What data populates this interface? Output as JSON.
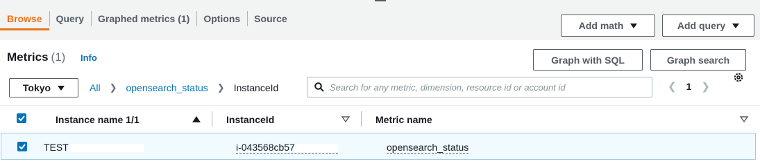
{
  "tabs": [
    {
      "label": "Browse",
      "active": true
    },
    {
      "label": "Query"
    },
    {
      "label": "Graphed metrics (1)"
    },
    {
      "label": "Options"
    },
    {
      "label": "Source"
    }
  ],
  "toolbar": {
    "add_math": "Add math",
    "add_query": "Add query"
  },
  "header": {
    "title": "Metrics",
    "count": "(1)",
    "info": "Info",
    "graph_with_sql": "Graph with SQL",
    "graph_search": "Graph search"
  },
  "filter": {
    "region": "Tokyo",
    "breadcrumbs": [
      "All",
      "opensearch_status",
      "InstanceId"
    ],
    "search_placeholder": "Search for any metric, dimension, resource id or account id",
    "page": "1"
  },
  "table": {
    "columns": [
      "Instance name 1/1",
      "InstanceId",
      "Metric name"
    ],
    "rows": [
      {
        "instance_name": "TEST",
        "instance_id": "i-043568cb57",
        "metric_name": "opensearch_status",
        "selected": true
      }
    ]
  },
  "colors": {
    "accent": "#ec7211",
    "link": "#0073bb",
    "checkbox": "#0073bb",
    "selected_row": "#f1faff"
  },
  "icons": [
    "search-icon",
    "gear-icon",
    "caret-down-icon",
    "chevron-left-icon",
    "chevron-right-icon",
    "sort-asc-icon",
    "sort-desc-icon",
    "check-icon"
  ]
}
